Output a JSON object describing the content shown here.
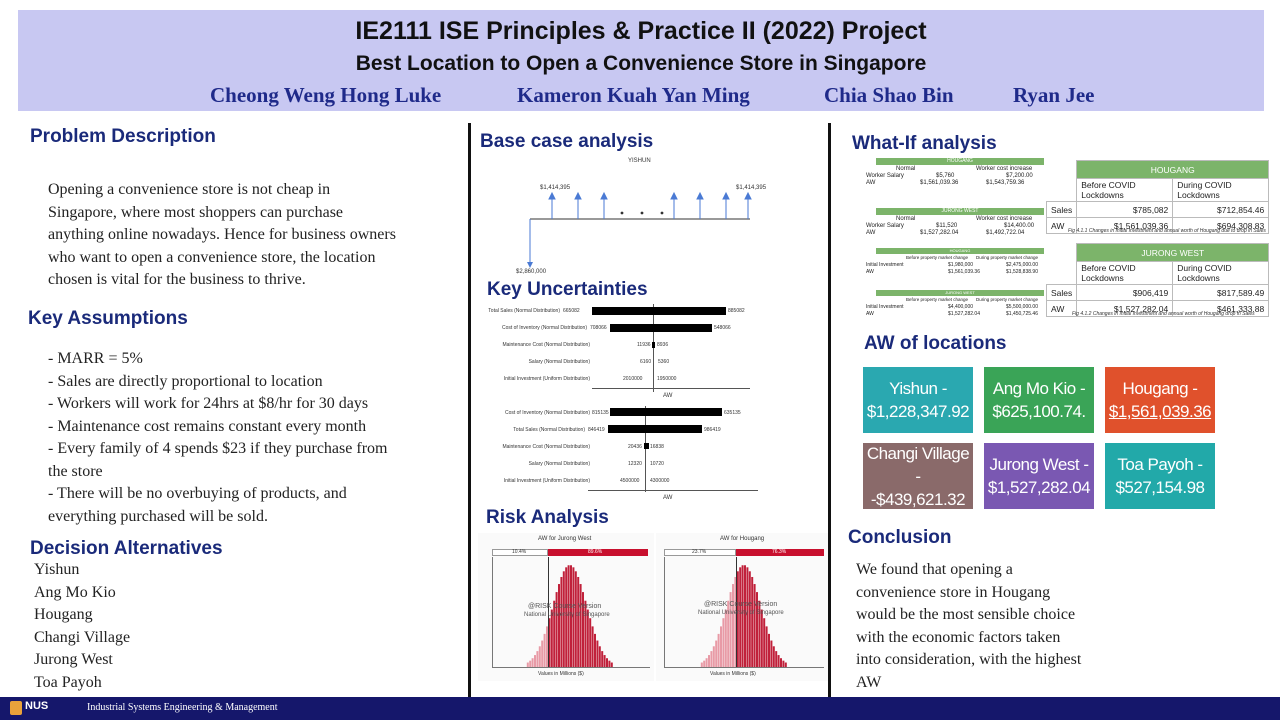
{
  "header": {
    "title": "IE2111 ISE Principles & Practice II (2022) Project",
    "subtitle": "Best Location to Open a Convenience Store in Singapore",
    "authors": [
      "Cheong Weng Hong Luke",
      "Kameron Kuah Yan Ming",
      "Chia Shao Bin",
      "Ryan Jee"
    ]
  },
  "problem": {
    "heading": "Problem Description",
    "lines": [
      "Opening a convenience store is not cheap in",
      "Singapore, where most shoppers can purchase",
      "anything online nowadays. Hence for business owners",
      "who want to open a convenience store, the location",
      "chosen is vital for the business to thrive."
    ]
  },
  "assumptions": {
    "heading": "Key Assumptions",
    "lines": [
      "- MARR = 5%",
      "- Sales are directly proportional to location",
      "- Workers will work for 24hrs at $8/hr for 30 days",
      "- Maintenance cost remains constant every month",
      "- Every family of 4 spends $23 if they purchase from",
      "the store",
      "- There will be no overbuying of products, and",
      "everything purchased will be sold."
    ]
  },
  "alternatives": {
    "heading": "Decision Alternatives",
    "items": [
      "Yishun",
      "Ang Mo Kio",
      "Hougang",
      "Changi Village",
      "Jurong West",
      "Toa Payoh"
    ]
  },
  "base_case": {
    "heading": "Base case analysis",
    "diagram_title": "YISHUN",
    "left_label": "$1,414,395",
    "right_label": "$1,414,395",
    "bottom_label": "$2,860,000"
  },
  "uncertainties": {
    "heading": "Key Uncertainties",
    "top_rows": [
      {
        "label": "Total Sales (Normal Distribution)",
        "low": "665082",
        "high": "885082"
      },
      {
        "label": "Cost of Inventory (Normal Distribution)",
        "low": "708066",
        "high": "548066"
      },
      {
        "label": "Maintenance Cost (Normal Distribution)",
        "low": "11936",
        "high": "8936"
      },
      {
        "label": "Salary (Normal Distribution)",
        "low": "6160",
        "high": "5360"
      },
      {
        "label": "Initial Investment (Uniform Distribution)",
        "low": "2010000",
        "high": "1950000"
      }
    ],
    "bottom_rows": [
      {
        "label": "Cost of Inventory (Normal Distribution)",
        "low": "815135",
        "high": "635135"
      },
      {
        "label": "Total Sales (Normal Distribution)",
        "low": "846419",
        "high": "986419"
      },
      {
        "label": "Maintenance Cost (Normal Distribution)",
        "low": "20436",
        "high": "16838"
      },
      {
        "label": "Salary (Normal Distribution)",
        "low": "12320",
        "high": "10720"
      },
      {
        "label": "Initial Investment (Uniform Distribution)",
        "low": "4500000",
        "high": "4300000"
      }
    ],
    "axis_label": "AW"
  },
  "risk": {
    "heading": "Risk Analysis",
    "left_title": "AW for Jurong West",
    "right_title": "AW for Hougang",
    "left_pcts": [
      "10.4%",
      "89.6%"
    ],
    "right_pcts": [
      "23.7%",
      "76.3%"
    ],
    "watermark1": "@RISK Course Version",
    "watermark2": "National University of Singapore",
    "left_xlabel": "Values in Millions ($)",
    "right_xlabel": "Values in Millions ($)"
  },
  "whatif": {
    "heading": "What-If analysis",
    "hougang_title": "HOUGANG",
    "hougang_cols": [
      "Before COVID Lockdowns",
      "During COVID Lockdowns"
    ],
    "hougang_rows": [
      {
        "label": "Sales",
        "before": "$785,082",
        "during": "$712,854.46"
      },
      {
        "label": "AW",
        "before": "$1,561,039.36",
        "during": "$694,308.83"
      }
    ],
    "hougang_caption": "Fig 4.1.1 Changes in Initial Investment and annual worth of Hougang due to drop in Sales",
    "jurong_title": "JURONG WEST",
    "jurong_cols": [
      "Before COVID Lockdowns",
      "During COVID Lockdowns"
    ],
    "jurong_rows": [
      {
        "label": "Sales",
        "before": "$906,419",
        "during": "$817,589.49"
      },
      {
        "label": "AW",
        "before": "$1,527,282.04",
        "during": "$461,333.88"
      }
    ],
    "jurong_caption": "Fig 4.1.2 Changes in Initial Investment and annual worth of Hougang drop in Sales",
    "mini": {
      "t1": "HOUGANG",
      "t1_cols": [
        "Normal",
        "Worker cost increase"
      ],
      "t1_rows": [
        [
          "Worker Salary",
          "$5,760",
          "$7,200.00"
        ],
        [
          "AW",
          "$1,561,039.36",
          "$1,543,759.36"
        ]
      ],
      "t2": "JURONG WEST",
      "t2_cols": [
        "Normal",
        "Worker cost increase"
      ],
      "t2_rows": [
        [
          "Worker Salary",
          "$11,520",
          "$14,400.00"
        ],
        [
          "AW",
          "$1,527,282.04",
          "$1,492,722.04"
        ]
      ],
      "t3": "HOUGANG",
      "t3_cols": [
        "Before property market change",
        "During property market change"
      ],
      "t3_rows": [
        [
          "Initial Investment",
          "$1,980,000",
          "$2,475,000.00"
        ],
        [
          "AW",
          "$1,561,039.36",
          "$1,528,838.90"
        ]
      ],
      "t4": "JURONG WEST",
      "t4_cols": [
        "Before property market change",
        "During property market change"
      ],
      "t4_rows": [
        [
          "Initial Investment",
          "$4,400,000",
          "$5,500,000.00"
        ],
        [
          "AW",
          "$1,527,282.04",
          "$1,450,725.46"
        ]
      ]
    }
  },
  "aw_locations": {
    "heading": "AW of locations",
    "tiles": [
      {
        "name": "Yishun -",
        "value": "$1,228,347.92",
        "color": "#2aa8b0"
      },
      {
        "name": "Ang Mo Kio -",
        "value": "$625,100.74.",
        "color": "#3aa457"
      },
      {
        "name": "Hougang -",
        "value": "$1,561,039.36",
        "color": "#e0512c"
      },
      {
        "name": "Changi Village -",
        "value": "-$439,621.32",
        "color": "#8a6a6a"
      },
      {
        "name": "Jurong West -",
        "value": "$1,527,282.04",
        "color": "#7a58b2"
      },
      {
        "name": "Toa Payoh -",
        "value": "$527,154.98",
        "color": "#22a9a9"
      }
    ]
  },
  "conclusion": {
    "heading": "Conclusion",
    "lines": [
      "We found that opening a",
      "convenience store in Hougang",
      "would be the most sensible choice",
      "with the economic factors taken",
      "into consideration, with the highest",
      "AW"
    ]
  },
  "footer": {
    "logo": "NUS",
    "text": "Industrial Systems Engineering & Management"
  }
}
